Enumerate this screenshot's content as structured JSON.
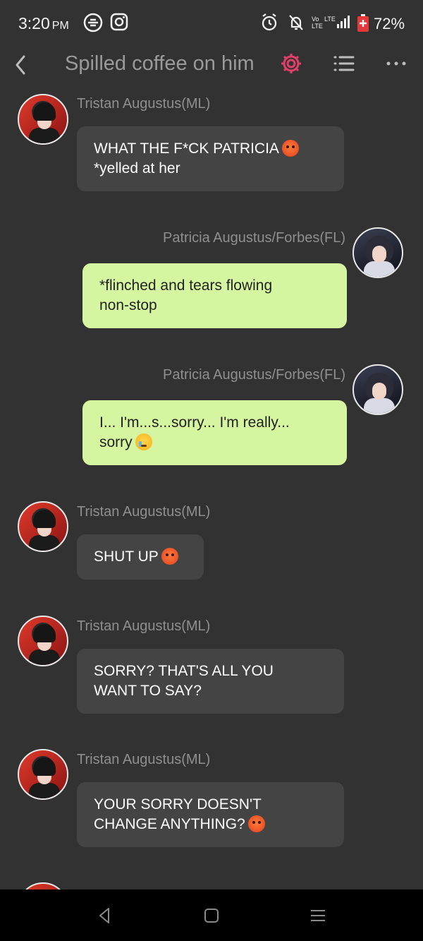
{
  "status_bar": {
    "time": "3:20",
    "ampm": "PM",
    "battery": "72%",
    "icons": [
      "link-icon",
      "instagram-icon",
      "alarm-icon",
      "notifications-off-icon",
      "volte-icon",
      "signal-icon",
      "battery-icon"
    ]
  },
  "header": {
    "title": "Spilled coffee on him",
    "accent_color": "#e0406a"
  },
  "messages": [
    {
      "sender": "Tristan Augustus(ML)",
      "line1": "WHAT THE F*CK PATRICIA",
      "line2": "*yelled at her",
      "emoji": "angry-face"
    },
    {
      "sender": "Patricia Augustus/Forbes(FL)",
      "line1": "*flinched and tears flowing",
      "line2": "non-stop"
    },
    {
      "sender": "Patricia Augustus/Forbes(FL)",
      "line1": "I... I'm...s...sorry... I'm really...",
      "line2": "sorry",
      "emoji": "crying-face"
    },
    {
      "sender": "Tristan Augustus(ML)",
      "line1": "SHUT UP",
      "emoji": "angry-face"
    },
    {
      "sender": "Tristan Augustus(ML)",
      "line1": "SORRY? THAT'S ALL YOU",
      "line2": "WANT TO SAY?"
    },
    {
      "sender": "Tristan Augustus(ML)",
      "line1": "YOUR SORRY DOESN'T",
      "line2": "CHANGE ANYTHING?",
      "emoji": "angry-face"
    }
  ],
  "colors": {
    "background": "#323232",
    "incoming_bubble": "#444444",
    "outgoing_bubble": "#d5f5a0",
    "sender_name": "#8f8f8f"
  }
}
